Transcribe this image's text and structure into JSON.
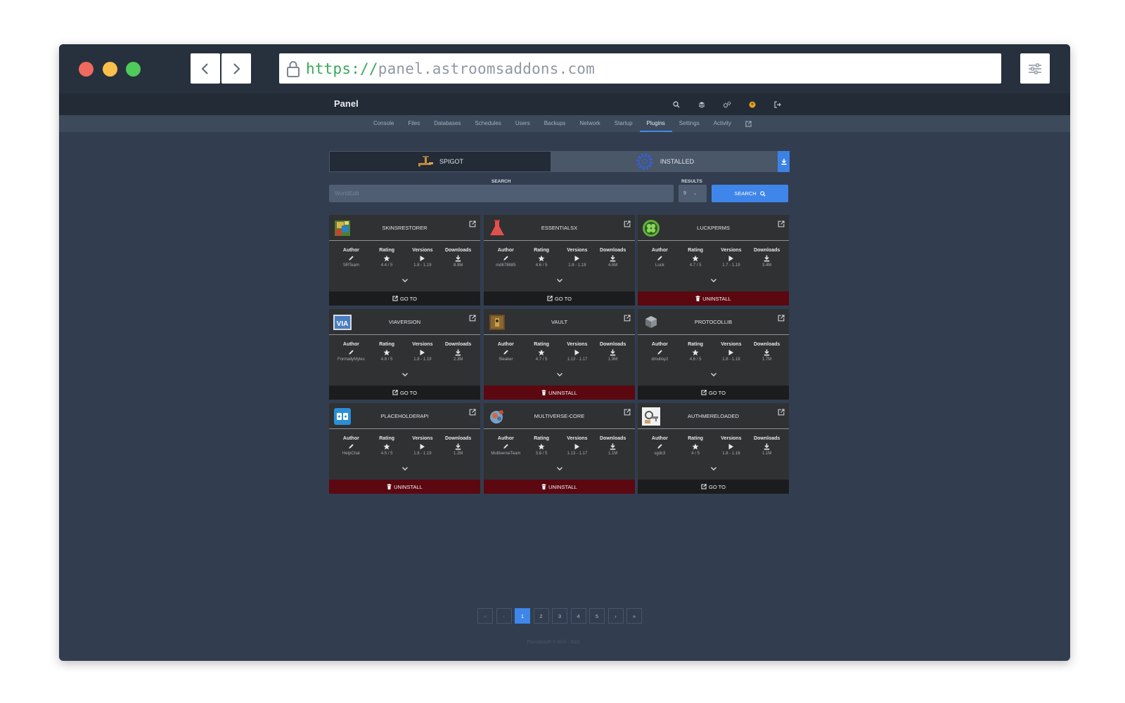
{
  "browser": {
    "url_scheme": "https://",
    "url_host": "panel.astroomsaddons.com",
    "icons": {
      "back": "chevron-left-icon",
      "forward": "chevron-right-icon",
      "lock": "lock-icon",
      "menu": "sliders-icon"
    }
  },
  "header": {
    "brand": "Panel",
    "icons": [
      "search-icon",
      "layers-icon",
      "cogs-icon",
      "avatar-icon",
      "logout-icon"
    ]
  },
  "nav": {
    "tabs": [
      "Console",
      "Files",
      "Databases",
      "Schedules",
      "Users",
      "Backups",
      "Network",
      "Startup",
      "Plugins",
      "Settings",
      "Activity"
    ],
    "active": "Plugins"
  },
  "source_tabs": {
    "spigot": "SPIGOT",
    "installed": "INSTALLED"
  },
  "search": {
    "label": "SEARCH",
    "placeholder": "WorldEdit",
    "results_label": "RESULTS",
    "results_value": "9",
    "button": "SEARCH"
  },
  "stat_labels": {
    "author": "Author",
    "rating": "Rating",
    "versions": "Versions",
    "downloads": "Downloads"
  },
  "plugins": [
    {
      "name": "SKINSRESTORER",
      "author": "SRTeam",
      "rating": "4.4 / 5",
      "versions": "1.8 - 1.19",
      "downloads": "8.9M",
      "action": "GO TO",
      "status": "goto",
      "logo": "skinsrestorer-logo"
    },
    {
      "name": "ESSENTIALSX",
      "author": "md678685",
      "rating": "4.6 / 5",
      "versions": "1.8 - 1.18",
      "downloads": "4.6M",
      "action": "GO TO",
      "status": "goto",
      "logo": "essentialsx-logo"
    },
    {
      "name": "LUCKPERMS",
      "author": "Luck",
      "rating": "4.7 / 5",
      "versions": "1.7 - 1.19",
      "downloads": "3.4M",
      "action": "UNINSTALL",
      "status": "uninstall",
      "logo": "luckperms-logo"
    },
    {
      "name": "VIAVERSION",
      "author": "FormallyMyles",
      "rating": "4.8 / 5",
      "versions": "1.8 - 1.19",
      "downloads": "2.3M",
      "action": "GO TO",
      "status": "goto",
      "logo": "viaversion-logo"
    },
    {
      "name": "VAULT",
      "author": "Sleaker",
      "rating": "4.7 / 5",
      "versions": "1.13 - 1.17",
      "downloads": "1.9M",
      "action": "UNINSTALL",
      "status": "uninstall",
      "logo": "vault-logo"
    },
    {
      "name": "PROTOCOLLIB",
      "author": "dmulloy2",
      "rating": "4.6 / 5",
      "versions": "1.8 - 1.18",
      "downloads": "1.7M",
      "action": "GO TO",
      "status": "goto",
      "logo": "protocollib-logo"
    },
    {
      "name": "PLACEHOLDERAPI",
      "author": "HelpChat",
      "rating": "4.5 / 5",
      "versions": "1.8 - 1.19",
      "downloads": "1.2M",
      "action": "UNINSTALL",
      "status": "uninstall",
      "logo": "placeholderapi-logo"
    },
    {
      "name": "MULTIVERSE-CORE",
      "author": "MultiverseTeam",
      "rating": "3.8 / 5",
      "versions": "1.13 - 1.17",
      "downloads": "1.1M",
      "action": "UNINSTALL",
      "status": "uninstall",
      "logo": "multiverse-logo"
    },
    {
      "name": "AUTHMERELOADED",
      "author": "sgdc3",
      "rating": "4 / 5",
      "versions": "1.8 - 1.16",
      "downloads": "1.1M",
      "action": "GO TO",
      "status": "goto",
      "logo": "authme-logo"
    }
  ],
  "pagination": {
    "first": "«",
    "prev": "‹",
    "pages": [
      "1",
      "2",
      "3",
      "4",
      "5"
    ],
    "active": "1",
    "next": "›",
    "last": "»"
  },
  "footer": "Pterodactyl® © 2015 - 2022",
  "colors": {
    "background": "#323e4f",
    "accent": "#3f86ea",
    "uninstall": "#5b0811",
    "card": "#2f3133"
  }
}
